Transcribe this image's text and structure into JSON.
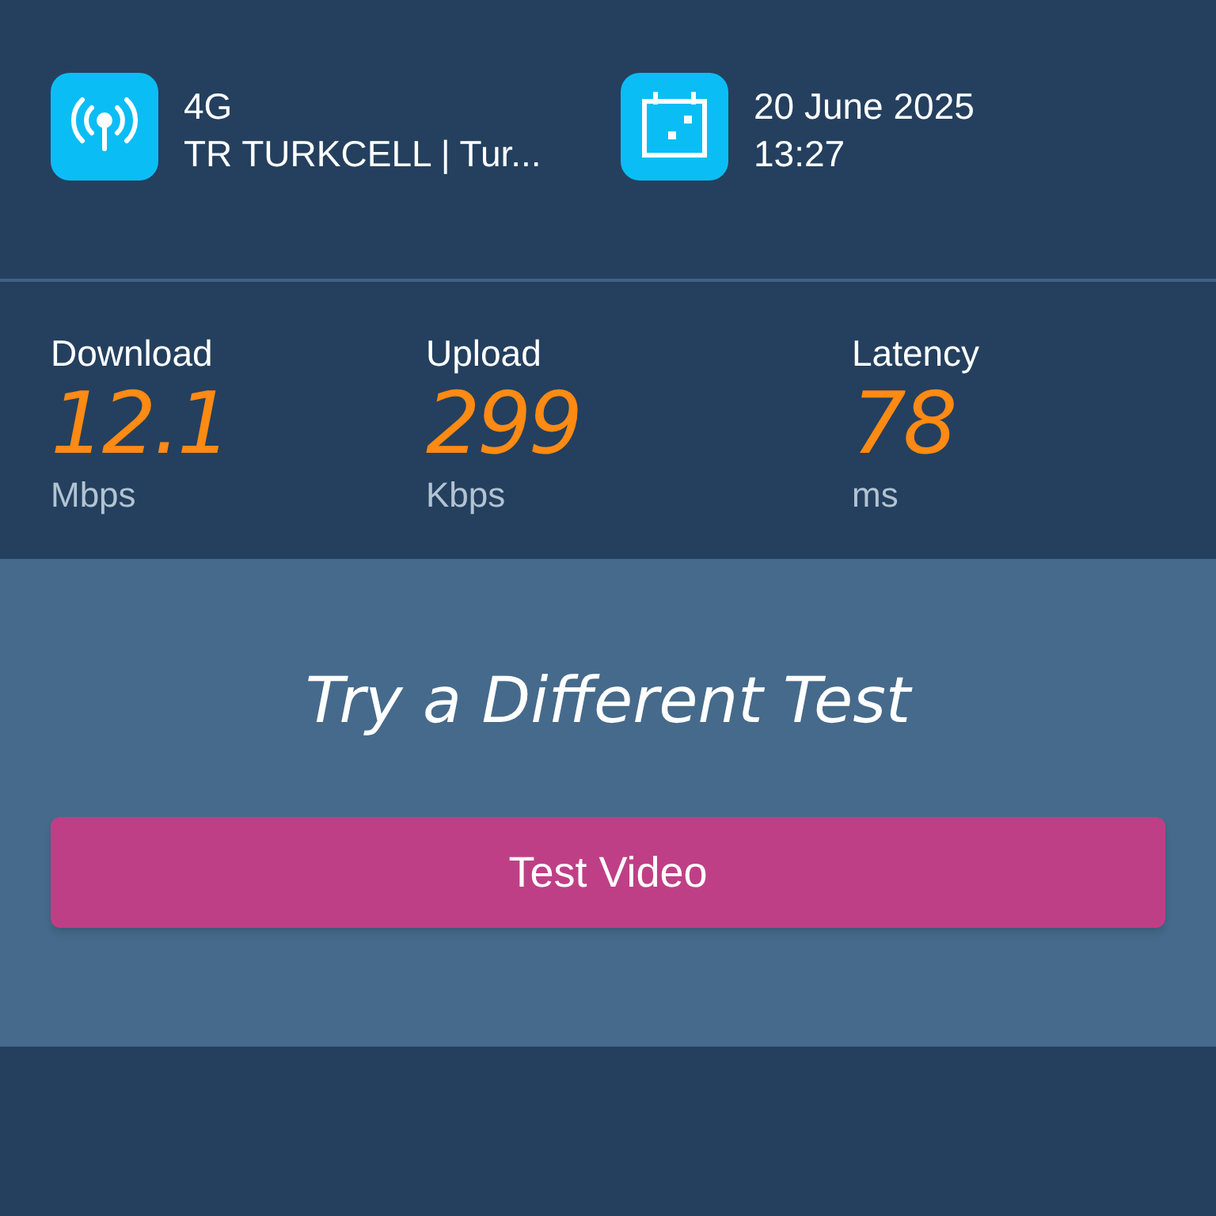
{
  "info": [
    {
      "kind": "network",
      "line_1": "4G",
      "line_2": "TR TURKCELL | Tur..."
    },
    {
      "kind": "date",
      "line_1": "20 June 2025",
      "line_2": "13:27"
    }
  ],
  "metrics": [
    {
      "label": "Download",
      "value": "12.1",
      "unit": "Mbps"
    },
    {
      "label": "Upload",
      "value": "299",
      "unit": "Kbps"
    },
    {
      "label": "Latency",
      "value": "78",
      "unit": "ms"
    }
  ],
  "promo": {
    "title": "Try a Different Test",
    "button": "Test Video"
  }
}
